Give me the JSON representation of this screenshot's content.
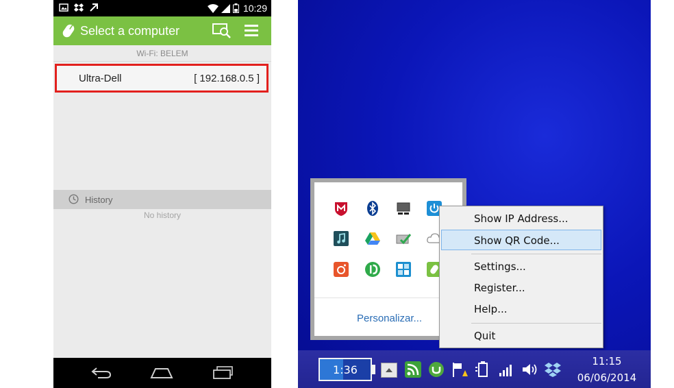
{
  "phone": {
    "status_bar": {
      "time": "10:29"
    },
    "app_bar": {
      "title": "Select a computer"
    },
    "wifi_label": "Wi-Fi: BELEM",
    "computers": [
      {
        "name": "Ultra-Dell",
        "ip": "[ 192.168.0.5 ]"
      }
    ],
    "history": {
      "label": "History",
      "empty_text": "No history"
    },
    "colors": {
      "app_bar": "#7bc143",
      "highlight": "#e2201d"
    }
  },
  "desktop": {
    "tray_popup": {
      "personalize_label": "Personalizar..."
    },
    "context_menu": {
      "items": [
        {
          "label": "Show IP Address..."
        },
        {
          "label": "Show QR Code..."
        },
        {
          "label": "Settings..."
        },
        {
          "label": "Register..."
        },
        {
          "label": "Help..."
        },
        {
          "label": "Quit"
        }
      ]
    },
    "taskbar": {
      "battery_time": "1:36",
      "clock_time": "11:15",
      "clock_date": "06/06/2014"
    },
    "colors": {
      "desktop_bg": "#0b16b8",
      "menu_hover": "#d5e8f8",
      "link": "#2a6db5"
    }
  }
}
